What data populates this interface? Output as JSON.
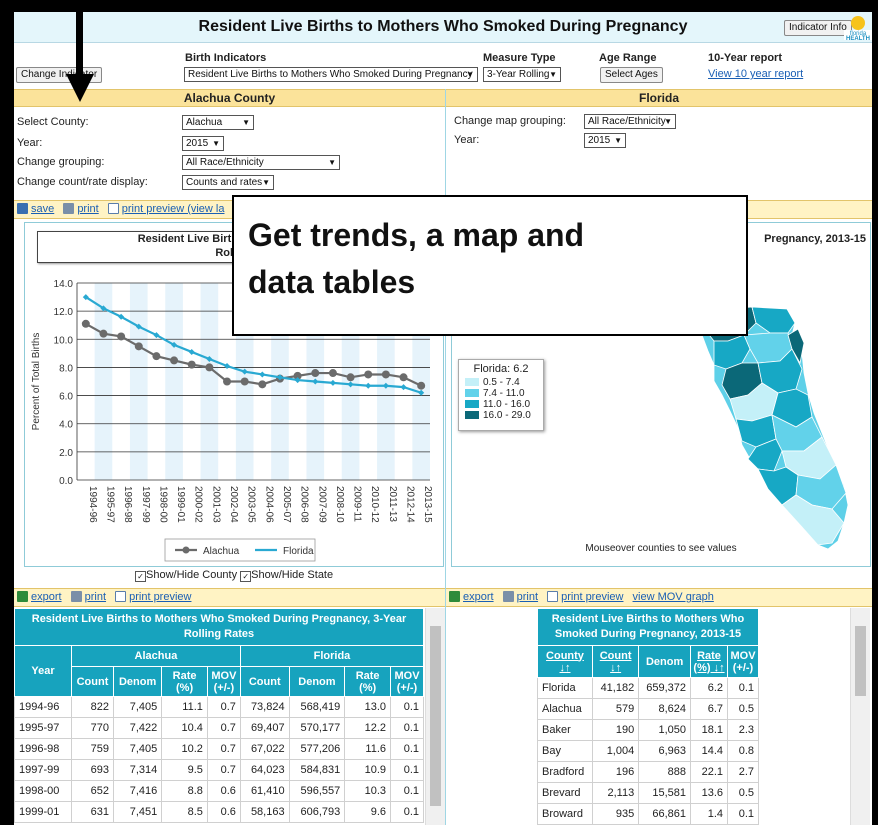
{
  "header": {
    "title": "Resident Live Births to Mothers Who Smoked During Pregnancy",
    "indicator_info": "Indicator Info",
    "logo_text": "florida HEALTH"
  },
  "controls": {
    "change_indicator": "Change Indicator",
    "birth_indicators_label": "Birth Indicators",
    "birth_indicator_value": "Resident Live Births to Mothers Who Smoked During Pregnancy",
    "measure_type_label": "Measure Type",
    "measure_type_value": "3-Year Rolling",
    "age_range_label": "Age Range",
    "select_ages": "Select Ages",
    "ten_year_label": "10-Year report",
    "ten_year_link": "View 10 year report"
  },
  "left_panel": {
    "title": "Alachua County",
    "select_county_label": "Select County:",
    "select_county_value": "Alachua",
    "year_label": "Year:",
    "year_value": "2015",
    "grouping_label": "Change grouping:",
    "grouping_value": "All Race/Ethnicity",
    "display_label": "Change count/rate display:",
    "display_value": "Counts and rates",
    "toolbar": {
      "save": "save",
      "print": "print",
      "print_preview": "print preview (view la"
    }
  },
  "right_panel": {
    "title": "Florida",
    "map_grouping_label": "Change map grouping:",
    "map_grouping_value": "All Race/Ethnicity",
    "year_label": "Year:",
    "year_value": "2015",
    "map_title_tail": "Pregnancy, 2013-15",
    "legend_title": "Florida: 6.2",
    "legend_items": [
      {
        "label": "0.5 - 7.4",
        "color": "#c4f0f8"
      },
      {
        "label": "7.4 - 11.0",
        "color": "#62d2ea"
      },
      {
        "label": "11.0 - 16.0",
        "color": "#17a8c5"
      },
      {
        "label": "16.0 - 29.0",
        "color": "#0b6878"
      }
    ],
    "mouseover_note": "Mouseover counties to see values"
  },
  "chart_title_line1": "Resident Live Births to Mothers Who",
  "chart_title_line2": "Rolling",
  "chart_data": {
    "type": "line",
    "title": "Resident Live Births to Mothers Who Smoked During Pregnancy, 3-Year Rolling",
    "ylabel": "Percent of Total Births",
    "ylim": [
      0,
      14
    ],
    "yticks": [
      "0.0",
      "2.0",
      "4.0",
      "6.0",
      "8.0",
      "10.0",
      "12.0",
      "14.0"
    ],
    "categories": [
      "1994-96",
      "1995-97",
      "1996-98",
      "1997-99",
      "1998-00",
      "1999-01",
      "2000-02",
      "2001-03",
      "2002-04",
      "2003-05",
      "2004-06",
      "2005-07",
      "2006-08",
      "2007-09",
      "2008-10",
      "2009-11",
      "2010-12",
      "2011-13",
      "2012-14",
      "2013-15"
    ],
    "series": [
      {
        "name": "Alachua",
        "color": "#6b6b6b",
        "values": [
          11.1,
          10.4,
          10.2,
          9.5,
          8.8,
          8.5,
          8.2,
          8.0,
          7.0,
          7.0,
          6.8,
          7.2,
          7.4,
          7.6,
          7.6,
          7.3,
          7.5,
          7.5,
          7.3,
          6.7
        ]
      },
      {
        "name": "Florida",
        "color": "#29a9d2",
        "values": [
          13.0,
          12.2,
          11.6,
          10.9,
          10.3,
          9.6,
          9.1,
          8.6,
          8.1,
          7.7,
          7.5,
          7.3,
          7.1,
          7.0,
          6.9,
          6.8,
          6.7,
          6.7,
          6.6,
          6.2
        ]
      }
    ],
    "legend_position": "bottom"
  },
  "show_hide": {
    "county": "Show/Hide County",
    "state": "Show/Hide State"
  },
  "bottom_left": {
    "toolbar": {
      "export": "export",
      "print": "print",
      "print_preview": "print preview"
    },
    "table_title": "Resident Live Births to Mothers Who Smoked During Pregnancy, 3-Year Rolling Rates",
    "group_alachua": "Alachua",
    "group_florida": "Florida",
    "columns": [
      "Year",
      "Count",
      "Denom",
      "Rate (%)",
      "MOV (+/-)",
      "Count",
      "Denom",
      "Rate (%)",
      "MOV (+/-)"
    ],
    "rows": [
      [
        "1994-96",
        "822",
        "7,405",
        "11.1",
        "0.7",
        "73,824",
        "568,419",
        "13.0",
        "0.1"
      ],
      [
        "1995-97",
        "770",
        "7,422",
        "10.4",
        "0.7",
        "69,407",
        "570,177",
        "12.2",
        "0.1"
      ],
      [
        "1996-98",
        "759",
        "7,405",
        "10.2",
        "0.7",
        "67,022",
        "577,206",
        "11.6",
        "0.1"
      ],
      [
        "1997-99",
        "693",
        "7,314",
        "9.5",
        "0.7",
        "64,023",
        "584,831",
        "10.9",
        "0.1"
      ],
      [
        "1998-00",
        "652",
        "7,416",
        "8.8",
        "0.6",
        "61,410",
        "596,557",
        "10.3",
        "0.1"
      ],
      [
        "1999-01",
        "631",
        "7,451",
        "8.5",
        "0.6",
        "58,163",
        "606,793",
        "9.6",
        "0.1"
      ]
    ]
  },
  "bottom_right": {
    "toolbar": {
      "export": "export",
      "print": "print",
      "print_preview": "print preview",
      "mov_graph": "view MOV graph"
    },
    "table_title": "Resident Live Births to Mothers Who Smoked During Pregnancy, 2013-15",
    "columns": [
      "County ↓↑",
      "Count ↓↑",
      "Denom",
      "Rate (%) ↓↑",
      "MOV (+/-)"
    ],
    "rows": [
      [
        "Florida",
        "41,182",
        "659,372",
        "6.2",
        "0.1"
      ],
      [
        "Alachua",
        "579",
        "8,624",
        "6.7",
        "0.5"
      ],
      [
        "Baker",
        "190",
        "1,050",
        "18.1",
        "2.3"
      ],
      [
        "Bay",
        "1,004",
        "6,963",
        "14.4",
        "0.8"
      ],
      [
        "Bradford",
        "196",
        "888",
        "22.1",
        "2.7"
      ],
      [
        "Brevard",
        "2,113",
        "15,581",
        "13.6",
        "0.5"
      ],
      [
        "Broward",
        "935",
        "66,861",
        "1.4",
        "0.1"
      ]
    ]
  },
  "callout": {
    "line1": "Get trends, a map and",
    "line2": "data tables"
  }
}
